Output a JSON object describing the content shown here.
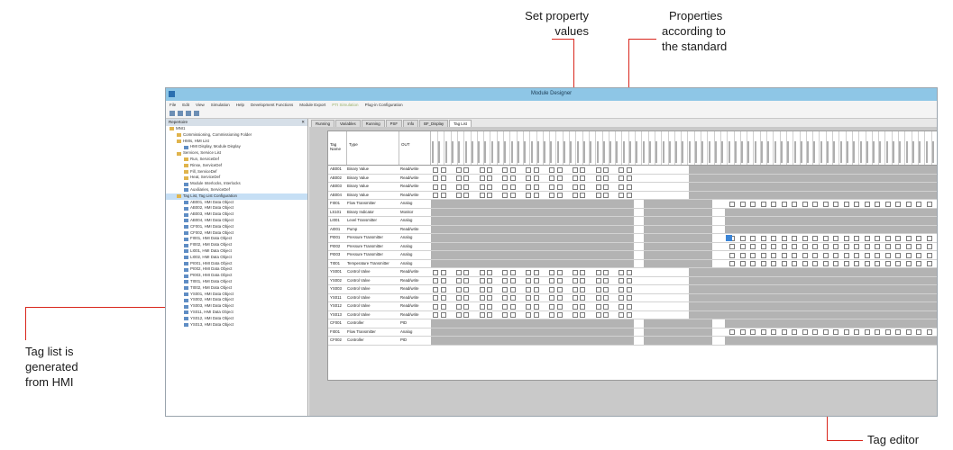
{
  "callouts": {
    "set_property": [
      "Set property",
      "values"
    ],
    "properties_standard": [
      "Properties",
      "according to",
      "the standard"
    ],
    "tag_list": [
      "Tag list is",
      "generated",
      "from HMI"
    ],
    "tag_editor": "Tag editor"
  },
  "colors": {
    "accent": "#d9261c",
    "titlebar": "#8ec6e6",
    "panel_grey": "#b3b3b3"
  },
  "window": {
    "title": "Module Designer",
    "menu": [
      "File",
      "Edit",
      "View",
      "Simulation",
      "Help",
      "Development Functions",
      "Module Export",
      "PTI Simulation",
      "Plug-in Configuration"
    ]
  },
  "tree": {
    "header": "Repertoire",
    "items": [
      {
        "label": "MNI1",
        "kind": "folder"
      },
      {
        "label": "Commissioning, Commissioning Folder",
        "kind": "folder"
      },
      {
        "label": "HMIs, HMI List",
        "kind": "folder"
      },
      {
        "label": "HMI Display, Module Display",
        "kind": "obj"
      },
      {
        "label": "Services, Service List",
        "kind": "folder"
      },
      {
        "label": "Run, ServiceDef",
        "kind": "folder"
      },
      {
        "label": "Rinse, ServiceDef",
        "kind": "folder"
      },
      {
        "label": "Fill, ServiceDef",
        "kind": "folder"
      },
      {
        "label": "Heat, ServiceDef",
        "kind": "folder"
      },
      {
        "label": "Module Interlocks, Interlocks",
        "kind": "obj"
      },
      {
        "label": "Auxiliaries, ServiceDef",
        "kind": "obj"
      },
      {
        "label": "Tag List, Tag List Configuration",
        "kind": "folder",
        "selected": true
      },
      {
        "label": "AB001, HMI Data Object",
        "kind": "obj"
      },
      {
        "label": "AB002, HMI Data Object",
        "kind": "obj"
      },
      {
        "label": "AB003, HMI Data Object",
        "kind": "obj"
      },
      {
        "label": "AB004, HMI Data Object",
        "kind": "obj"
      },
      {
        "label": "CF001, HMI Data Object",
        "kind": "obj"
      },
      {
        "label": "CF002, HMI Data Object",
        "kind": "obj"
      },
      {
        "label": "FI001, HMI Data Object",
        "kind": "obj"
      },
      {
        "label": "FI002, HMI Data Object",
        "kind": "obj"
      },
      {
        "label": "LI001, HMI Data Object",
        "kind": "obj"
      },
      {
        "label": "LI002, HMI Data Object",
        "kind": "obj"
      },
      {
        "label": "PI001, HMI Data Object",
        "kind": "obj"
      },
      {
        "label": "PI002, HMI Data Object",
        "kind": "obj"
      },
      {
        "label": "PI003, HMI Data Object",
        "kind": "obj"
      },
      {
        "label": "TI001, HMI Data Object",
        "kind": "obj"
      },
      {
        "label": "TI002, HMI Data Object",
        "kind": "obj"
      },
      {
        "label": "YS001, HMI Data Object",
        "kind": "obj"
      },
      {
        "label": "YS002, HMI Data Object",
        "kind": "obj"
      },
      {
        "label": "YS003, HMI Data Object",
        "kind": "obj"
      },
      {
        "label": "YS011, HMI Data Object",
        "kind": "obj"
      },
      {
        "label": "YS012, HMI Data Object",
        "kind": "obj"
      },
      {
        "label": "YS013, HMI Data Object",
        "kind": "obj"
      }
    ]
  },
  "tabs": [
    "Running",
    "Variables",
    "Running",
    "PSF",
    "Info",
    "BF_Display",
    "Tag List"
  ],
  "grid": {
    "headers": {
      "tag": "Tag Name",
      "type": "Type",
      "class": "OUT"
    },
    "rows": [
      {
        "tag": "AB001",
        "type": "Binary Value",
        "cls": "Read/write"
      },
      {
        "tag": "AB002",
        "type": "Binary Value",
        "cls": "Read/write"
      },
      {
        "tag": "AB003",
        "type": "Binary Value",
        "cls": "Read/write"
      },
      {
        "tag": "AB004",
        "type": "Binary Value",
        "cls": "Read/write"
      },
      {
        "tag": "FI001",
        "type": "Flow Transmitter",
        "cls": "Analog"
      },
      {
        "tag": "LS101",
        "type": "Binary Indicator",
        "cls": "Monitor"
      },
      {
        "tag": "LI001",
        "type": "Level Transmitter",
        "cls": "Analog"
      },
      {
        "tag": "AI001",
        "type": "Pump",
        "cls": "Read/write"
      },
      {
        "tag": "PI001",
        "type": "Pressure Transmitter",
        "cls": "Analog"
      },
      {
        "tag": "PI002",
        "type": "Pressure Transmitter",
        "cls": "Analog"
      },
      {
        "tag": "PI003",
        "type": "Pressure Transmitter",
        "cls": "Analog"
      },
      {
        "tag": "TI001",
        "type": "Temperature Transmitter",
        "cls": "Analog"
      },
      {
        "tag": "YS001",
        "type": "Control Valve",
        "cls": "Read/write"
      },
      {
        "tag": "YS002",
        "type": "Control Valve",
        "cls": "Read/write"
      },
      {
        "tag": "YS003",
        "type": "Control Valve",
        "cls": "Read/write"
      },
      {
        "tag": "YS011",
        "type": "Control Valve",
        "cls": "Read/write"
      },
      {
        "tag": "YS012",
        "type": "Control Valve",
        "cls": "Read/write"
      },
      {
        "tag": "YS013",
        "type": "Control Valve",
        "cls": "Read/write"
      },
      {
        "tag": "CF001",
        "type": "Controller",
        "cls": "PID"
      },
      {
        "tag": "FI001",
        "type": "Flow Transmitter",
        "cls": "Analog"
      },
      {
        "tag": "CF002",
        "type": "Controller",
        "cls": "PID"
      }
    ]
  }
}
